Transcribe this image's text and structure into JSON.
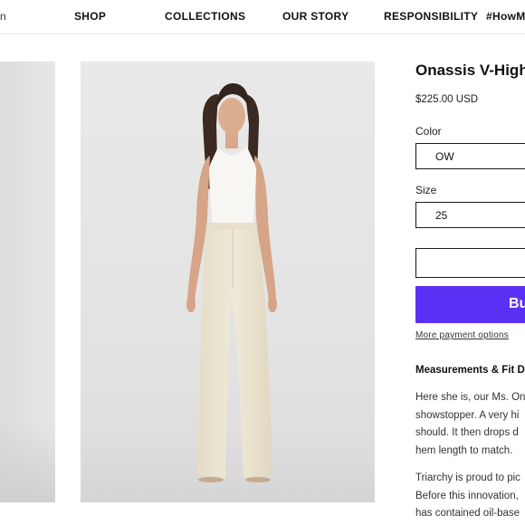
{
  "nav": {
    "fragment": "n",
    "items": [
      "SHOP",
      "COLLECTIONS",
      "OUR STORY",
      "RESPONSIBILITY",
      "#HowM"
    ]
  },
  "product": {
    "title": "Onassis V-High",
    "price": "$225.00 USD",
    "color_label": "Color",
    "color_value": "OW",
    "size_label": "Size",
    "size_value": "25",
    "buy_label": "Bu",
    "more_payment": "More payment options"
  },
  "description": {
    "heading": "Measurements & Fit De",
    "paragraph1": [
      "Here she is, our Ms. One",
      "showstopper. A very hi",
      "should. It then drops d",
      "hem length to match."
    ],
    "paragraph2": [
      "Triarchy is proud to pic",
      "Before this innovation,",
      "has contained oil-base"
    ]
  },
  "colors": {
    "accent": "#5a31f4",
    "border": "#1a1a1a"
  },
  "icons": {
    "model_photo": "product-photo",
    "side_photo": "product-photo-partial"
  }
}
